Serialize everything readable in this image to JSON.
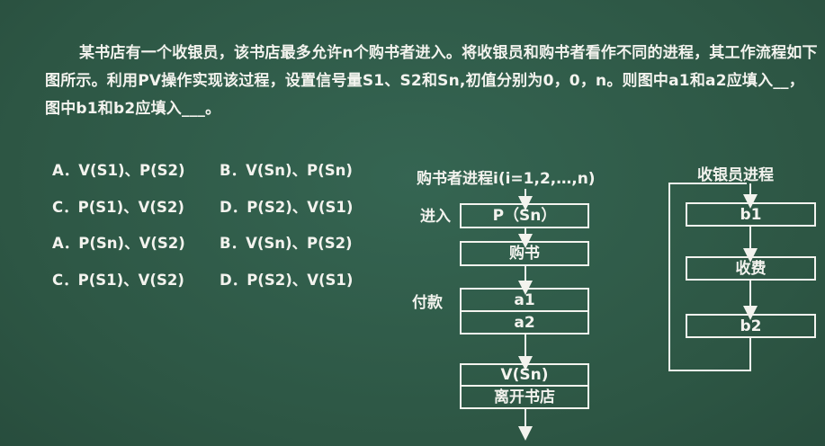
{
  "question": "某书店有一个收银员，该书店最多允许n个购书者进入。将收银员和购书者看作不同的进程，其工作流程如下图所示。利用PV操作实现该过程，设置信号量S1、S2和Sn,初值分别为0，0，n。则图中a1和a2应填入__，图中b1和b2应填入___。",
  "options": [
    {
      "left": "A．V(S1)、P(S2)",
      "right": "B．V(Sn)、P(Sn)"
    },
    {
      "left": "C．P(S1)、V(S2)",
      "right": "D．P(S2)、V(S1)"
    },
    {
      "left": "A．P(Sn)、V(S2)",
      "right": "B．V(Sn)、P(S2)"
    },
    {
      "left": "C．P(S1)、V(S2)",
      "right": "D．P(S2)、V(S1)"
    }
  ],
  "buyer": {
    "title": "购书者进程i(i=1,2,…,n)",
    "label_enter": "进入",
    "label_pay": "付款",
    "boxes": [
      "P（Sn）",
      "购书",
      "a1",
      "a2",
      "V(Sn)",
      "离开书店"
    ]
  },
  "cashier": {
    "title": "收银员进程",
    "boxes": [
      "b1",
      "收费",
      "b2"
    ]
  }
}
